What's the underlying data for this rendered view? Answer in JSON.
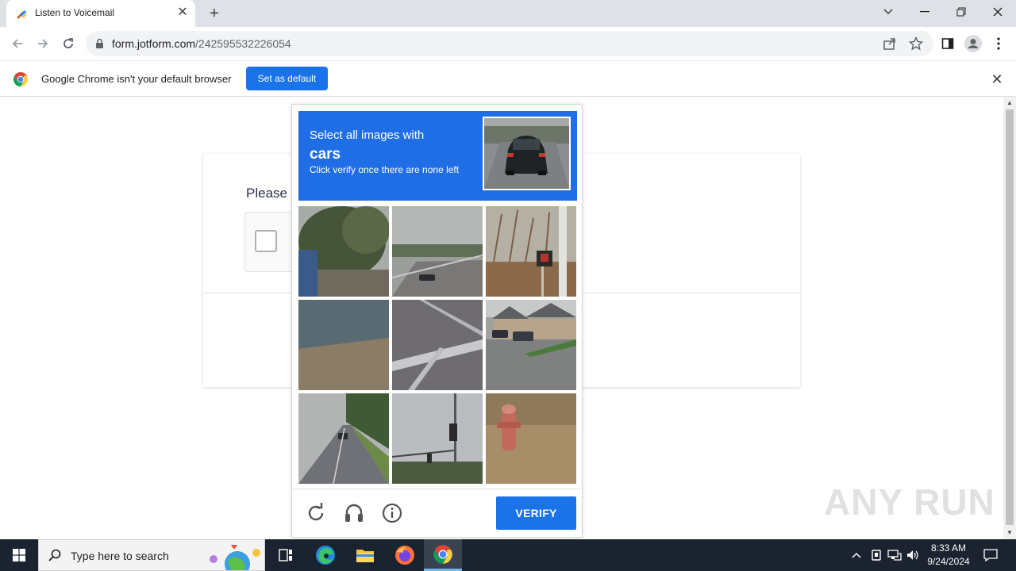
{
  "browser": {
    "tab_title": "Listen to Voicemail",
    "tab_close": "✕",
    "new_tab": "+",
    "url_host": "form.jotform.com",
    "url_path": "/242595532226054"
  },
  "infobar": {
    "message": "Google Chrome isn't your default browser",
    "button": "Set as default",
    "close": "✕"
  },
  "form": {
    "prompt_fragment": "Please v"
  },
  "captcha": {
    "line1": "Select all images with",
    "target_word": "cars",
    "line3": "Click verify once there are none left",
    "verify_label": "VERIFY",
    "tiles": [
      "tree-and-fence",
      "road-with-car",
      "crosswalk-signal",
      "wall-and-grass",
      "road-crosswalk",
      "parking-lot-cars",
      "highway-cars",
      "traffic-lights",
      "fire-hydrant"
    ]
  },
  "watermark": "ANY RUN",
  "taskbar": {
    "search_placeholder": "Type here to search",
    "time": "8:33 AM",
    "date": "9/24/2024"
  },
  "colors": {
    "accent": "#1a73e8",
    "captcha_header": "#1f6ee5",
    "taskbar": "#1b2330"
  }
}
